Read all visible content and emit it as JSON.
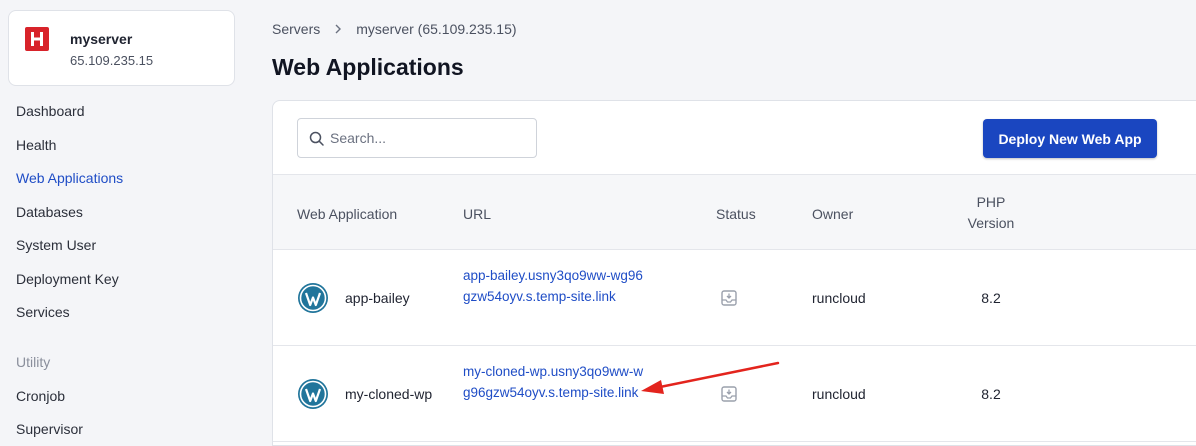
{
  "server": {
    "name": "myserver",
    "ip": "65.109.235.15",
    "logo_letter": "H"
  },
  "sidebar": {
    "items": [
      {
        "label": "Dashboard"
      },
      {
        "label": "Health"
      },
      {
        "label": "Web Applications"
      },
      {
        "label": "Databases"
      },
      {
        "label": "System User"
      },
      {
        "label": "Deployment Key"
      },
      {
        "label": "Services"
      }
    ],
    "section_utility": "Utility",
    "utility_items": [
      {
        "label": "Cronjob"
      },
      {
        "label": "Supervisor"
      }
    ]
  },
  "breadcrumb": {
    "root": "Servers",
    "current": "myserver (65.109.235.15)"
  },
  "page": {
    "title": "Web Applications"
  },
  "toolbar": {
    "search_placeholder": "Search...",
    "deploy_label": "Deploy New Web App"
  },
  "table": {
    "headers": {
      "app": "Web Application",
      "url": "URL",
      "status": "Status",
      "owner": "Owner",
      "php_line1": "PHP",
      "php_line2": "Version"
    },
    "rows": [
      {
        "name": "app-bailey",
        "url": "app-bailey.usny3qo9ww-wg96gzw54oyv.s.temp-site.link",
        "owner": "runcloud",
        "php": "8.2"
      },
      {
        "name": "my-cloned-wp",
        "url": "my-cloned-wp.usny3qo9ww-wg96gzw54oyv.s.temp-site.link",
        "owner": "runcloud",
        "php": "8.2"
      }
    ]
  },
  "colors": {
    "accent": "#1f4dc6",
    "button": "#1a46c0",
    "logo": "#d8232a",
    "wordpress": "#21759b",
    "annotation_arrow": "#e3241d"
  }
}
